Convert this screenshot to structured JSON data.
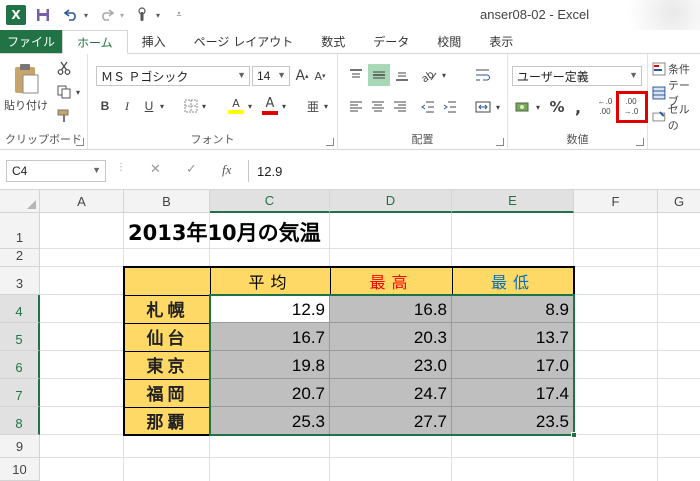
{
  "app": {
    "window_title": "anser08-02 - Excel",
    "logo_letter": "X"
  },
  "tabs": [
    "ファイル",
    "ホーム",
    "挿入",
    "ページ レイアウト",
    "数式",
    "データ",
    "校閲",
    "表示"
  ],
  "ribbon": {
    "clipboard": {
      "label": "クリップボード",
      "paste": "貼り付け"
    },
    "font": {
      "label": "フォント",
      "name": "ＭＳ Ｐゴシック",
      "size": "14",
      "grow": "A",
      "shrink": "A",
      "bold": "B",
      "italic": "I",
      "underline": "U",
      "fill_glyph": "A",
      "color_glyph": "A",
      "phonetic": "亜"
    },
    "alignment": {
      "label": "配置"
    },
    "number": {
      "label": "数値",
      "format": "ユーザー定義",
      "percent": "%",
      "comma": ",",
      "inc_decimal_top": ".00",
      "inc_decimal_bottom": "→.0",
      "dec_decimal_top": "←.0",
      "dec_decimal_bottom": ".00"
    },
    "styles": {
      "conditional": "条件",
      "table": "テーブ",
      "cell": "セルの"
    }
  },
  "formula_bar": {
    "name_box": "C4",
    "formula": "12.9",
    "fx": "fx"
  },
  "columns": [
    "A",
    "B",
    "C",
    "D",
    "E",
    "F",
    "G"
  ],
  "rows": [
    "1",
    "2",
    "3",
    "4",
    "5",
    "6",
    "7",
    "8",
    "9",
    "10"
  ],
  "sheet": {
    "title": "2013年10月の気温",
    "headers": {
      "avg": "平均",
      "max": "最高",
      "min": "最低"
    },
    "header_colors": {
      "avg": "#000000",
      "max": "#ff0000",
      "min": "#0070c0"
    },
    "cities": [
      "札幌",
      "仙台",
      "東京",
      "福岡",
      "那覇"
    ],
    "data": [
      [
        "12.9",
        "16.8",
        "8.9"
      ],
      [
        "16.7",
        "20.3",
        "13.7"
      ],
      [
        "19.8",
        "23.0",
        "17.0"
      ],
      [
        "20.7",
        "24.7",
        "17.4"
      ],
      [
        "25.3",
        "27.7",
        "23.5"
      ]
    ]
  },
  "colors": {
    "excel_green": "#217346",
    "header_fill": "#ffd966",
    "data_fill": "#bfbfbf",
    "highlight": "#e00000"
  }
}
